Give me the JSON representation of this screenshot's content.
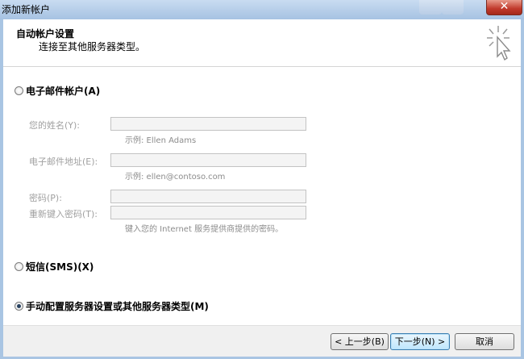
{
  "window": {
    "title": "添加新帐户",
    "close_glyph": "✕"
  },
  "header": {
    "title": "自动帐户设置",
    "subtitle": "连接至其他服务器类型。"
  },
  "options": {
    "email_account": {
      "label": "电子邮件帐户(A)",
      "selected": false
    },
    "sms": {
      "label": "短信(SMS)(X)",
      "selected": false
    },
    "manual": {
      "label": "手动配置服务器设置或其他服务器类型(M)",
      "selected": true
    }
  },
  "fields": {
    "name": {
      "label": "您的姓名(Y):",
      "value": "",
      "hint": "示例: Ellen Adams"
    },
    "email": {
      "label": "电子邮件地址(E):",
      "value": "",
      "hint": "示例: ellen@contoso.com"
    },
    "password": {
      "label": "密码(P):",
      "value": ""
    },
    "retype_password": {
      "label": "重新键入密码(T):",
      "value": "",
      "hint": "键入您的 Internet 服务提供商提供的密码。"
    }
  },
  "buttons": {
    "prev": "< 上一步(B)",
    "next": "下一步(N) >",
    "cancel": "取消"
  },
  "icons": {
    "header_icon": "cursor-sparkle-icon"
  }
}
